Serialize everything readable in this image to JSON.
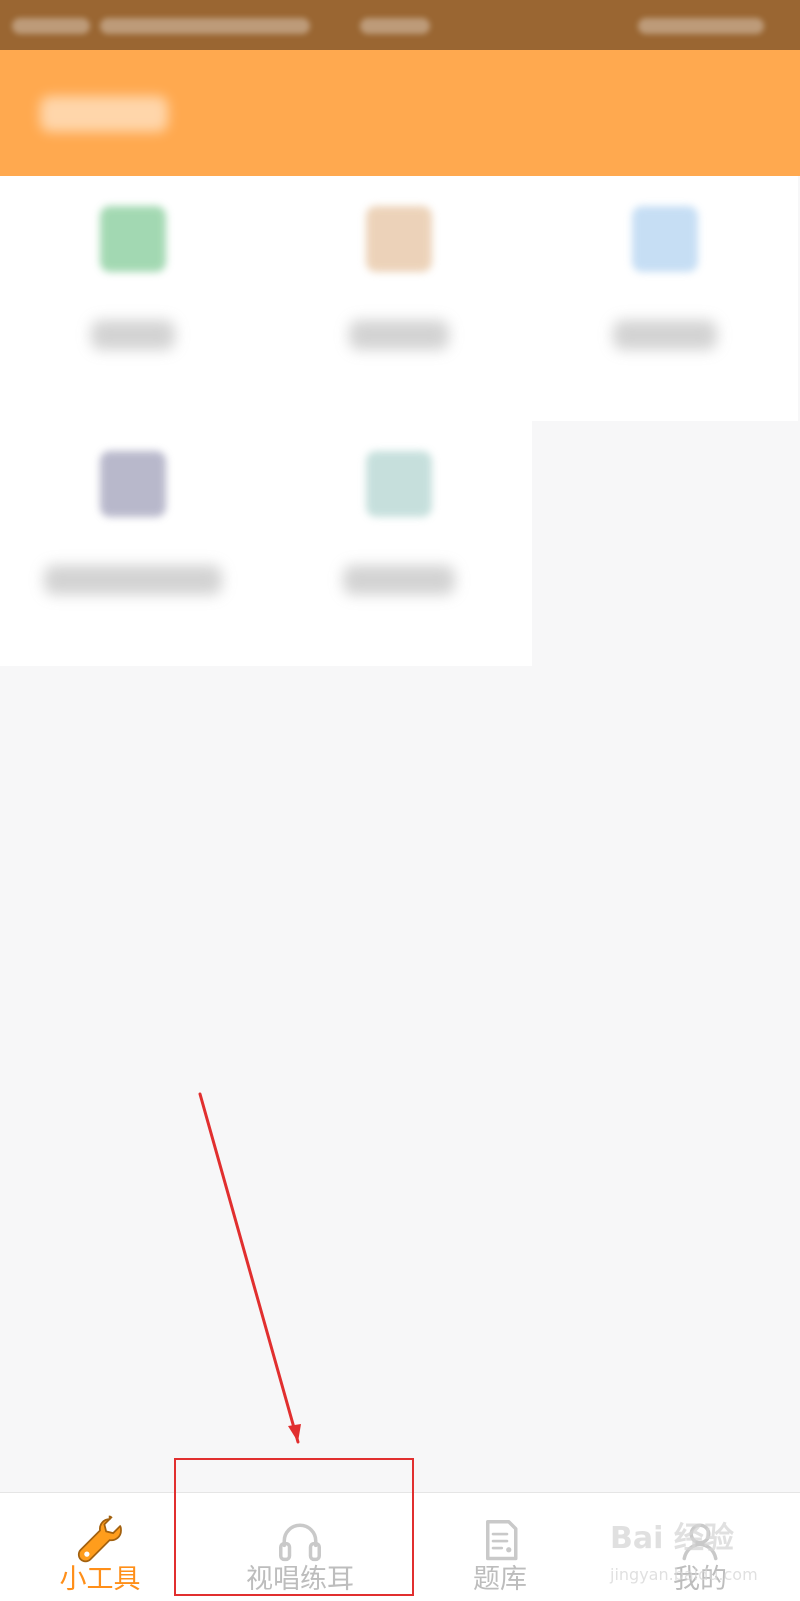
{
  "status_bar": {
    "background": "#9a6632"
  },
  "header": {
    "background": "#ffa94f"
  },
  "tools": {
    "items": [
      {
        "icon": "music-icon",
        "color": "#8ccf9f"
      },
      {
        "icon": "person-icon",
        "color": "#e8c8a8"
      },
      {
        "icon": "book-icon",
        "color": "#b8d6f2"
      },
      {
        "icon": "grid-icon",
        "color": "#a7a7bf"
      },
      {
        "icon": "calendar-icon",
        "color": "#b8d8d4"
      }
    ]
  },
  "tabs": [
    {
      "label": "小工具",
      "icon": "wrench-icon",
      "active": true
    },
    {
      "label": "视唱练耳",
      "icon": "headphones-icon",
      "active": false
    },
    {
      "label": "题库",
      "icon": "document-icon",
      "active": false
    },
    {
      "label": "我的",
      "icon": "user-icon",
      "active": false
    }
  ],
  "watermark": {
    "main": "Bai 经验",
    "sub": "jingyan.baidu.com"
  },
  "colors": {
    "active_tab": "#ff8f19",
    "inactive_tab": "#bdbdbd",
    "annotation_red": "#e12f2f"
  }
}
